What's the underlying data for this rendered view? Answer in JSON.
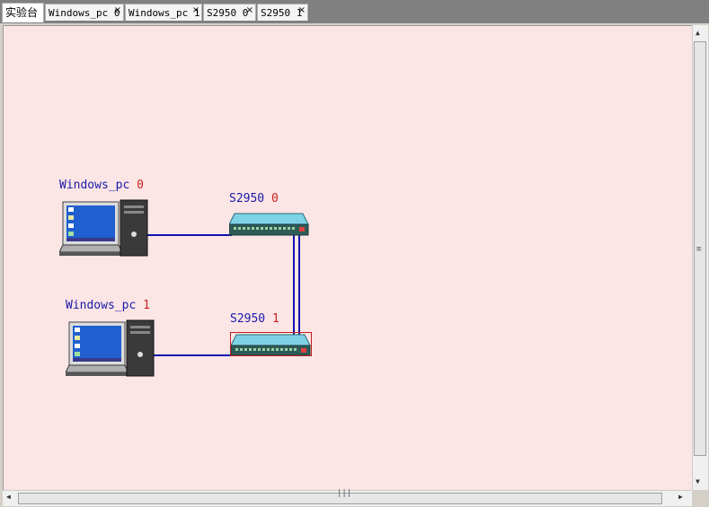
{
  "tabs": [
    {
      "label": "实验台",
      "active": true
    },
    {
      "label": "Windows_pc 0",
      "close": "×"
    },
    {
      "label": "Windows_pc 1",
      "close": "×"
    },
    {
      "label": "S2950 0",
      "close": "×"
    },
    {
      "label": "S2950 1",
      "close": "×"
    }
  ],
  "devices": {
    "pc0": {
      "name": "Windows_pc",
      "index": "0",
      "type": "windows-pc"
    },
    "pc1": {
      "name": "Windows_pc",
      "index": "1",
      "type": "windows-pc"
    },
    "sw0": {
      "name": "S2950",
      "index": "0",
      "type": "switch"
    },
    "sw1": {
      "name": "S2950",
      "index": "1",
      "type": "switch",
      "selected": true
    }
  },
  "links": [
    {
      "from": "pc0",
      "to": "sw0"
    },
    {
      "from": "pc1",
      "to": "sw1"
    },
    {
      "from": "sw0",
      "to": "sw1"
    },
    {
      "from": "sw0",
      "to": "sw1"
    }
  ],
  "colors": {
    "canvas_bg": "#fbe5e5",
    "link": "#1010b0",
    "label_name": "#1a1aa8",
    "label_index": "#cc2020"
  },
  "scrollbars": {
    "vertical_grip": "≡",
    "horizontal_grip": "|||"
  }
}
